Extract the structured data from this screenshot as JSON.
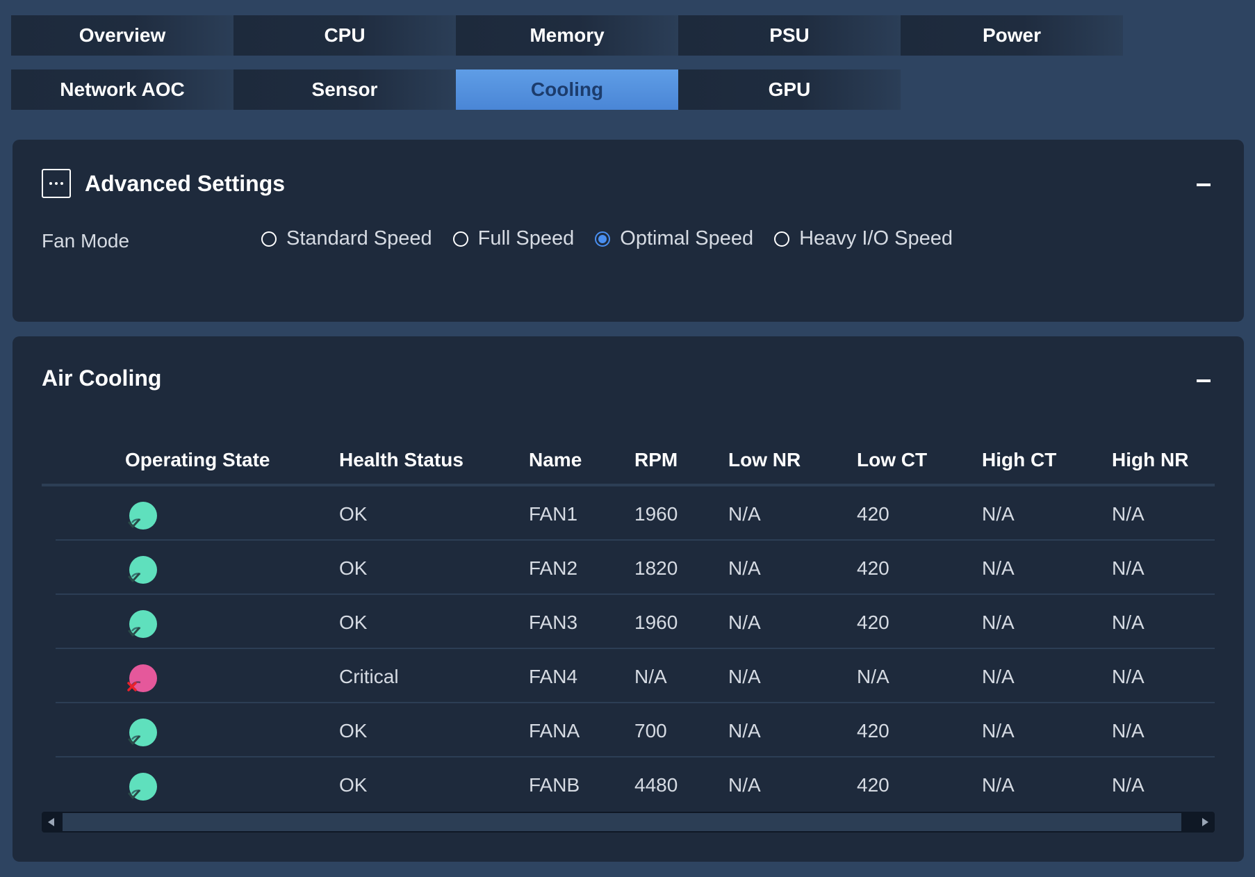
{
  "tabs": {
    "row1": [
      "Overview",
      "CPU",
      "Memory",
      "PSU",
      "Power"
    ],
    "row2": [
      "Network AOC",
      "Sensor",
      "Cooling",
      "GPU"
    ],
    "active": "Cooling"
  },
  "advanced_settings": {
    "title": "Advanced Settings",
    "fan_mode_label": "Fan Mode",
    "options": [
      "Standard Speed",
      "Full Speed",
      "Optimal Speed",
      "Heavy I/O Speed"
    ],
    "selected": "Optimal Speed"
  },
  "air_cooling": {
    "title": "Air Cooling",
    "columns": [
      "Operating State",
      "Health Status",
      "Name",
      "RPM",
      "Low NR",
      "Low CT",
      "High CT",
      "High NR"
    ],
    "rows": [
      {
        "state": "ok",
        "health": "OK",
        "name": "FAN1",
        "rpm": "1960",
        "low_nr": "N/A",
        "low_ct": "420",
        "high_ct": "N/A",
        "high_nr": "N/A"
      },
      {
        "state": "ok",
        "health": "OK",
        "name": "FAN2",
        "rpm": "1820",
        "low_nr": "N/A",
        "low_ct": "420",
        "high_ct": "N/A",
        "high_nr": "N/A"
      },
      {
        "state": "ok",
        "health": "OK",
        "name": "FAN3",
        "rpm": "1960",
        "low_nr": "N/A",
        "low_ct": "420",
        "high_ct": "N/A",
        "high_nr": "N/A"
      },
      {
        "state": "critical",
        "health": "Critical",
        "name": "FAN4",
        "rpm": "N/A",
        "low_nr": "N/A",
        "low_ct": "N/A",
        "high_ct": "N/A",
        "high_nr": "N/A"
      },
      {
        "state": "ok",
        "health": "OK",
        "name": "FANA",
        "rpm": "700",
        "low_nr": "N/A",
        "low_ct": "420",
        "high_ct": "N/A",
        "high_nr": "N/A"
      },
      {
        "state": "ok",
        "health": "OK",
        "name": "FANB",
        "rpm": "4480",
        "low_nr": "N/A",
        "low_ct": "420",
        "high_ct": "N/A",
        "high_nr": "N/A"
      }
    ]
  },
  "icons": {
    "ok": "fan-ok-icon",
    "critical": "fan-critical-icon",
    "more": "more-options-icon",
    "collapse": "collapse-icon"
  },
  "colors": {
    "background": "#2e4461",
    "panel": "#1e2a3c",
    "active_tab": "#5f9de6",
    "ok": "#5fe0bd",
    "critical": "#e5589b",
    "radio_selected": "#4a8ff0"
  }
}
